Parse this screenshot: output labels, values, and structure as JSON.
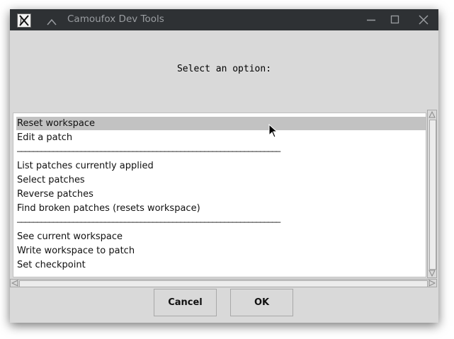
{
  "window": {
    "title": "Camoufox Dev Tools",
    "icons": [
      "x11-app-icon",
      "shade-chevron-up-icon",
      "minimize-icon",
      "maximize-icon",
      "close-icon"
    ]
  },
  "prompt": "Select an option:",
  "list": {
    "items": [
      {
        "label": "Reset workspace",
        "selected": true
      },
      {
        "label": "Edit a patch"
      },
      {
        "label": "──────────────────────────────────────────────────────────────────",
        "separator": true
      },
      {
        "label": "List patches currently applied"
      },
      {
        "label": "Select patches"
      },
      {
        "label": "Reverse patches"
      },
      {
        "label": "Find broken patches (resets workspace)"
      },
      {
        "label": "──────────────────────────────────────────────────────────────────",
        "separator": true
      },
      {
        "label": "See current workspace"
      },
      {
        "label": "Write workspace to patch"
      },
      {
        "label": "Set checkpoint"
      }
    ]
  },
  "buttons": {
    "cancel": "Cancel",
    "ok": "OK"
  },
  "colors": {
    "titlebar": "#2e3134",
    "window_bg": "#d9d9d9",
    "selection": "#c2c2c2"
  }
}
